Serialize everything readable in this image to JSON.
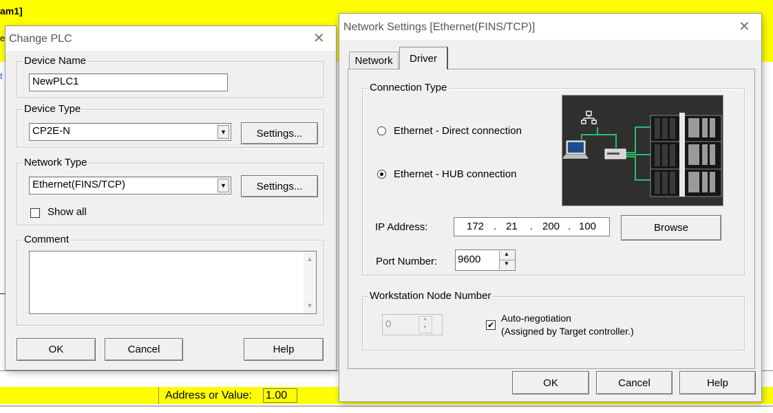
{
  "background": {
    "title_fragment": "am1]",
    "left_edge_fragment_1": "e",
    "left_edge_fragment_2": "t",
    "address_label": "Address or Value:",
    "address_value": "1.00"
  },
  "change_plc": {
    "title": "Change PLC",
    "device_name": {
      "legend": "Device Name",
      "value": "NewPLC1"
    },
    "device_type": {
      "legend": "Device Type",
      "value": "CP2E-N",
      "settings_label": "Settings..."
    },
    "network_type": {
      "legend": "Network Type",
      "value": "Ethernet(FINS/TCP)",
      "settings_label": "Settings...",
      "show_all_label": "Show all",
      "show_all_checked": false
    },
    "comment": {
      "legend": "Comment",
      "value": ""
    },
    "buttons": {
      "ok": "OK",
      "cancel": "Cancel",
      "help": "Help"
    }
  },
  "network_settings": {
    "title": "Network Settings [Ethernet(FINS/TCP)]",
    "tabs": [
      {
        "label": "Network",
        "active": false
      },
      {
        "label": "Driver",
        "active": true
      }
    ],
    "connection_type": {
      "legend": "Connection Type",
      "options": [
        {
          "label": "Ethernet - Direct connection",
          "selected": false
        },
        {
          "label": "Ethernet - HUB connection",
          "selected": true
        }
      ]
    },
    "ip_address": {
      "label": "IP Address:",
      "octets": [
        "172",
        "21",
        "200",
        "100"
      ],
      "browse_label": "Browse"
    },
    "port_number": {
      "label": "Port Number:",
      "value": "9600"
    },
    "workstation_node": {
      "legend": "Workstation Node Number",
      "value": "0",
      "auto_line1": "Auto-negotiation",
      "auto_line2": "(Assigned by Target controller.)",
      "auto_checked": true
    },
    "buttons": {
      "ok": "OK",
      "cancel": "Cancel",
      "help": "Help"
    },
    "icons": [
      "network-topology-icon",
      "laptop-icon",
      "hub-icon",
      "plc-rack-icon"
    ]
  },
  "colors": {
    "highlight": "#ffff00",
    "window_bg": "#f0f0f0",
    "diagram_bg": "#2f2f2f",
    "diagram_link": "#27c26a"
  }
}
